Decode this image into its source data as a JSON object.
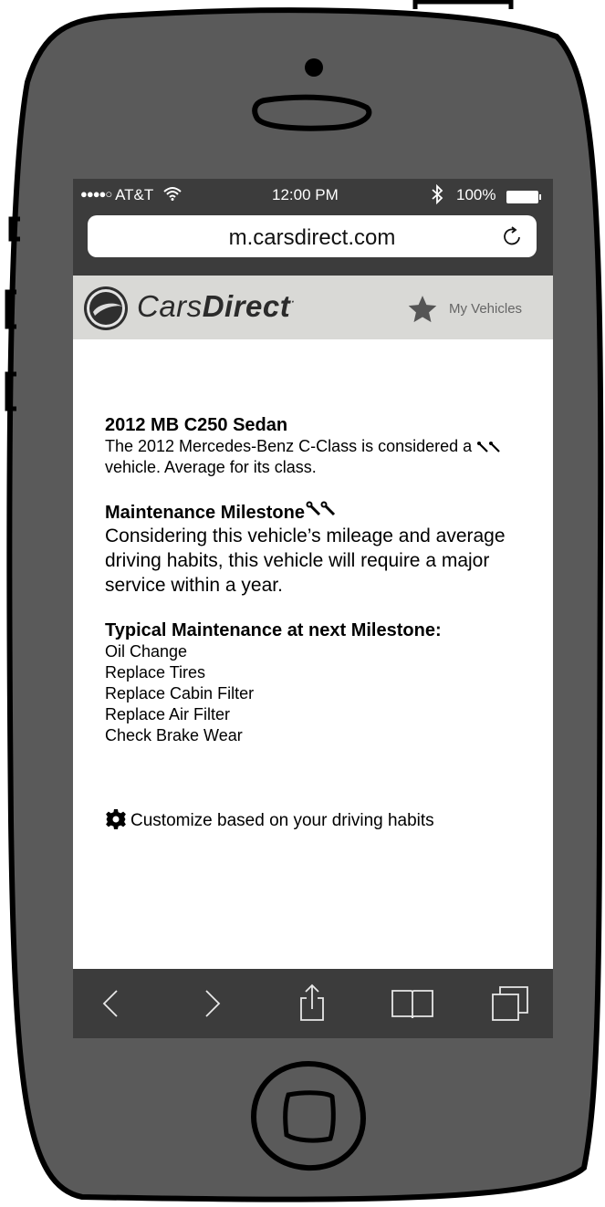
{
  "status_bar": {
    "signal": "●●●●○",
    "carrier": "AT&T",
    "wifi_icon": "wifi-icon",
    "time": "12:00 PM",
    "bluetooth_icon": "bluetooth-icon",
    "battery": "100%"
  },
  "browser": {
    "url": "m.carsdirect.com",
    "reload_icon": "reload-icon"
  },
  "site_header": {
    "logo_light": "Cars",
    "logo_bold": "Direct",
    "logo_mark": "·",
    "my_vehicles_label": "My Vehicles",
    "background": "#d9d9d6"
  },
  "vehicle": {
    "title": "2012 MB C250 Sedan",
    "desc_before": "The 2012 Mercedes-Benz C-Class is considered a",
    "desc_after": "vehicle. Average for its class."
  },
  "milestone": {
    "title": "Maintenance Milestone",
    "body": "Considering this vehicle’s mileage and average driving habits, this vehicle will require a major service within a year."
  },
  "typical": {
    "title": "Typical Maintenance at next Milestone:",
    "items": [
      "Oil Change",
      "Replace Tires",
      "Replace Cabin Filter",
      "Replace Air Filter",
      "Check Brake Wear"
    ]
  },
  "customize_label": "Customize based on your driving habits",
  "toolbar": {
    "back_icon": "back-icon",
    "forward_icon": "forward-icon",
    "share_icon": "share-icon",
    "bookmarks_icon": "bookmarks-icon",
    "tabs_icon": "tabs-icon"
  },
  "colors": {
    "phone_body": "#5a5a5a",
    "chrome": "#3c3c3c",
    "accent_text": "#666666"
  }
}
